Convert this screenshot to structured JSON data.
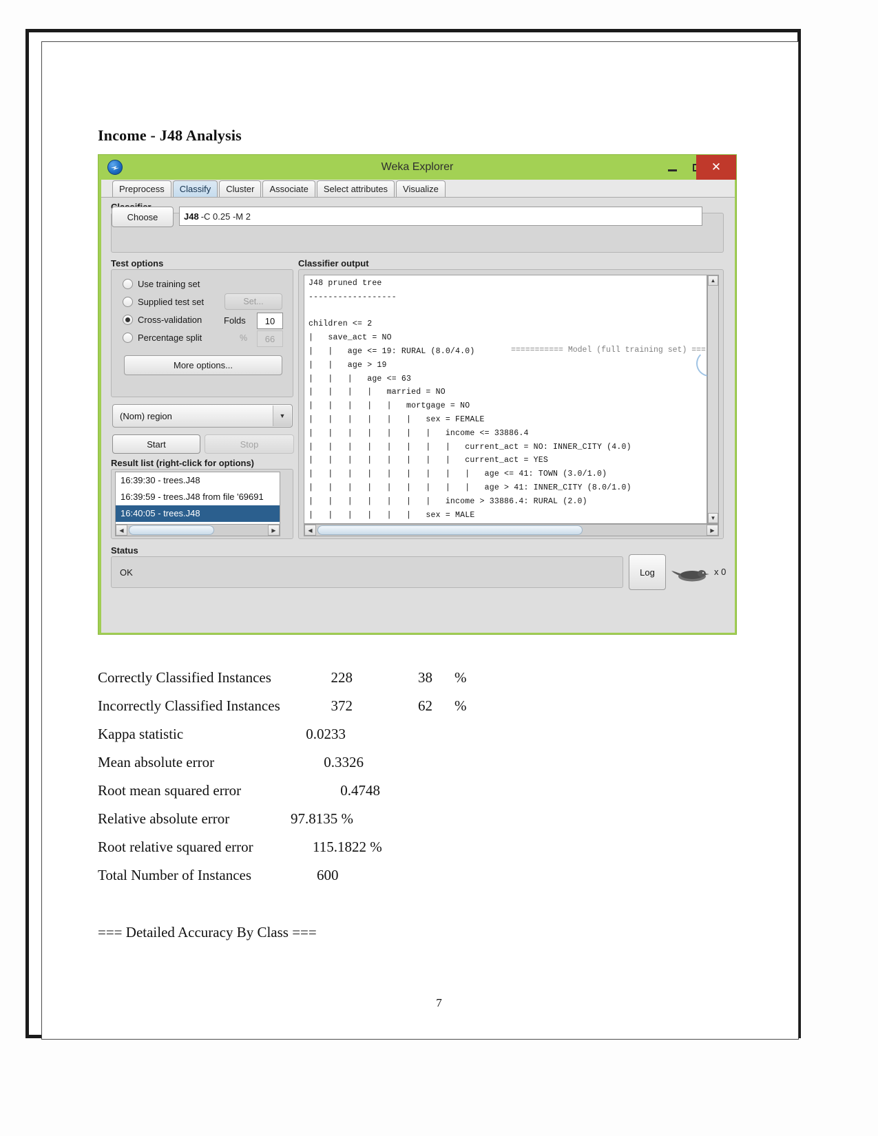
{
  "document": {
    "heading": "Income - J48 Analysis",
    "page_number": "7",
    "detailed_accuracy_heading": "=== Detailed Accuracy By Class ==="
  },
  "window": {
    "title": "Weka Explorer",
    "logo_icon": "weka-bird-logo-icon",
    "controls": {
      "minimize": "minimize-icon",
      "maximize": "maximize-icon",
      "close": "✕"
    },
    "titlebar_color": "#a3d154",
    "close_color": "#c0392b"
  },
  "tabs": [
    {
      "label": "Preprocess",
      "active": false
    },
    {
      "label": "Classify",
      "active": true
    },
    {
      "label": "Cluster",
      "active": false
    },
    {
      "label": "Associate",
      "active": false
    },
    {
      "label": "Select attributes",
      "active": false
    },
    {
      "label": "Visualize",
      "active": false
    }
  ],
  "classifier": {
    "group_label": "Classifier",
    "choose_label": "Choose",
    "scheme_name": "J48",
    "scheme_options": "-C 0.25 -M 2"
  },
  "test_options": {
    "group_label": "Test options",
    "options": [
      {
        "label": "Use training set",
        "selected": false
      },
      {
        "label": "Supplied test set",
        "selected": false
      },
      {
        "label": "Cross-validation",
        "selected": true
      },
      {
        "label": "Percentage split",
        "selected": false
      }
    ],
    "set_button": "Set...",
    "folds_label": "Folds",
    "folds_value": "10",
    "percent_sign": "%",
    "percent_value": "66",
    "more_options": "More options..."
  },
  "class_attribute": {
    "selected": "(Nom) region",
    "dropdown_icon": "chevron-down-icon"
  },
  "run_controls": {
    "start": "Start",
    "stop": "Stop"
  },
  "result_list": {
    "label": "Result list (right-click for options)",
    "items": [
      {
        "text": "16:39:30 - trees.J48",
        "selected": false
      },
      {
        "text": "16:39:59 - trees.J48 from file '69691",
        "selected": false
      },
      {
        "text": "16:40:05 - trees.J48",
        "selected": true
      }
    ]
  },
  "classifier_output": {
    "label": "Classifier output",
    "cut_top_line": "=========== Model (full training set) ===",
    "text": "J48 pruned tree\n------------------\n\nchildren <= 2\n|   save_act = NO\n|   |   age <= 19: RURAL (8.0/4.0)\n|   |   age > 19\n|   |   |   age <= 63\n|   |   |   |   married = NO\n|   |   |   |   |   mortgage = NO\n|   |   |   |   |   |   sex = FEMALE\n|   |   |   |   |   |   |   income <= 33886.4\n|   |   |   |   |   |   |   |   current_act = NO: INNER_CITY (4.0)\n|   |   |   |   |   |   |   |   current_act = YES\n|   |   |   |   |   |   |   |   |   age <= 41: TOWN (3.0/1.0)\n|   |   |   |   |   |   |   |   |   age > 41: INNER_CITY (8.0/1.0)\n|   |   |   |   |   |   |   income > 33886.4: RURAL (2.0)\n|   |   |   |   |   |   sex = MALE"
  },
  "status": {
    "label": "Status",
    "value": "OK",
    "log_button": "Log",
    "bird_icon": "weka-bird-icon",
    "bird_count": "x 0"
  },
  "statistics": [
    {
      "label": "Correctly Classified Instances",
      "value1": "228",
      "value2": "38",
      "value3": "%"
    },
    {
      "label": "Incorrectly Classified Instances",
      "value1": "372",
      "value2": "62",
      "value3": "%"
    },
    {
      "label": "Kappa statistic",
      "value1": "0.0233",
      "value2": "",
      "value3": ""
    },
    {
      "label": "Mean absolute error",
      "value1": "0.3326",
      "value2": "",
      "value3": ""
    },
    {
      "label": "Root mean squared error",
      "value1": "0.4748",
      "value2": "",
      "value3": ""
    },
    {
      "label": "Relative absolute error",
      "value1": "97.8135 %",
      "value2": "",
      "value3": ""
    },
    {
      "label": "Root relative squared error",
      "value1": "115.1822 %",
      "value2": "",
      "value3": ""
    },
    {
      "label": "Total Number of Instances",
      "value1": "600",
      "value2": "",
      "value3": ""
    }
  ]
}
